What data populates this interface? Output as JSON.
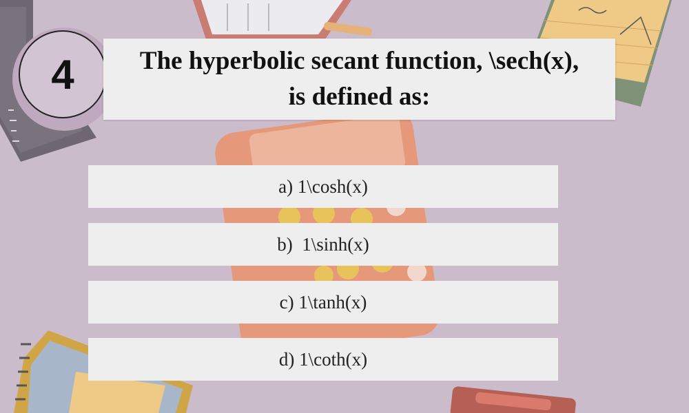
{
  "question": {
    "number": "4",
    "text": "The hyperbolic secant function, \\sech(x), is defined as:"
  },
  "options": [
    {
      "label": "a) 1\\cosh(x)"
    },
    {
      "label": "b)  1\\sinh(x)"
    },
    {
      "label": "c) 1\\tanh(x)"
    },
    {
      "label": "d) 1\\coth(x)"
    }
  ]
}
